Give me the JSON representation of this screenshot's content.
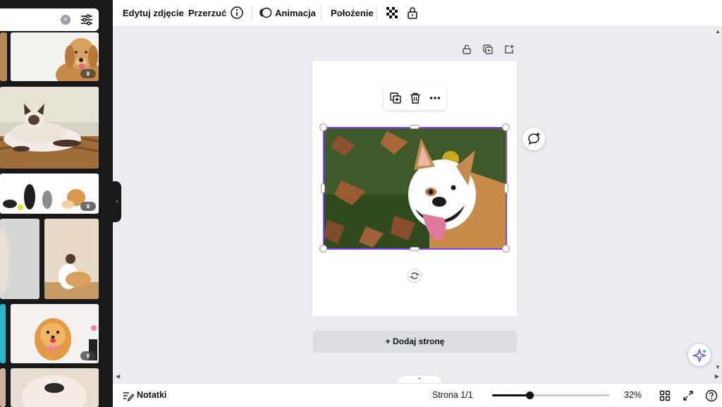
{
  "search": {
    "value": ""
  },
  "topbar": {
    "edit_photo": "Edytuj zdjęcie",
    "flip": "Przerzuć",
    "animation": "Animacja",
    "position": "Położenie"
  },
  "canvas": {
    "add_page": "+ Dodaj stronę"
  },
  "bottombar": {
    "notes": "Notatki",
    "page_indicator": "Strona 1/1",
    "zoom_label": "32%",
    "zoom_level": 0.32
  },
  "colors": {
    "accent": "#8b3dff",
    "panel_bg": "#18191b",
    "canvas_bg": "#ebecf0"
  },
  "icons": [
    "clear-icon",
    "filter-icon",
    "info-icon",
    "animation-icon",
    "transparency-icon",
    "lock-icon",
    "unlock-icon",
    "duplicate-icon",
    "add-page-icon",
    "trash-icon",
    "more-icon",
    "rotate-icon",
    "comment-add-icon",
    "magic-sparkle-icon",
    "notes-icon",
    "grid-view-icon",
    "fullscreen-icon",
    "help-icon",
    "crown-icon",
    "chevron-left-icon",
    "chevron-up-icon"
  ]
}
